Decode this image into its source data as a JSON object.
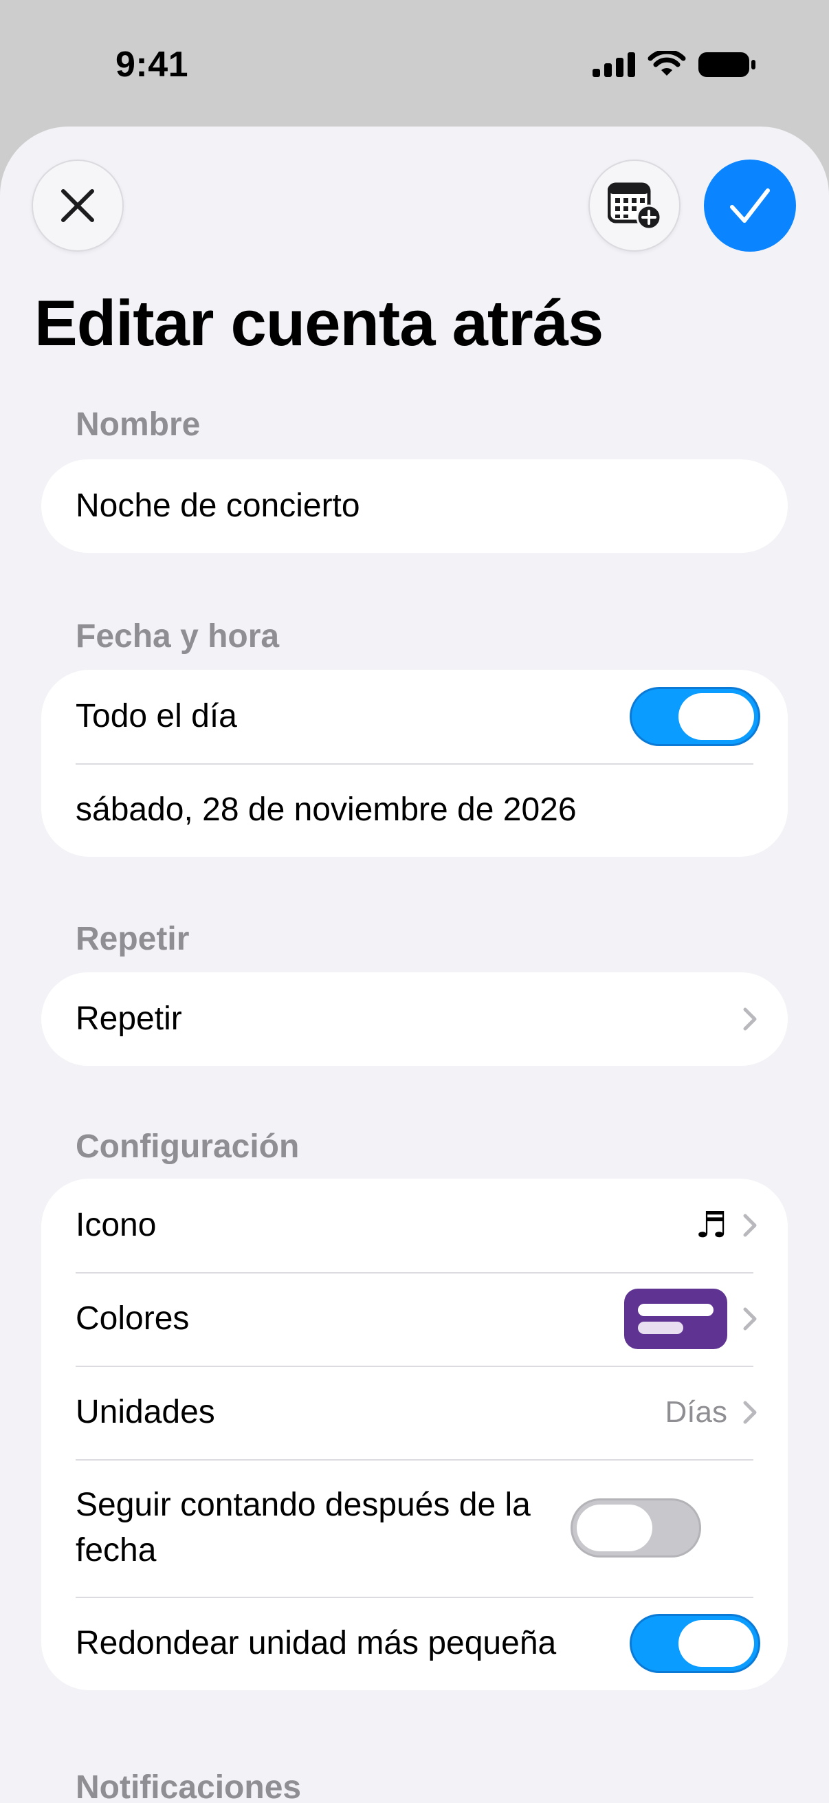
{
  "status_bar": {
    "time": "9:41"
  },
  "page": {
    "title": "Editar cuenta atrás"
  },
  "nav": {
    "close_icon": "close-icon",
    "calendar_add_icon": "calendar-add-icon",
    "done_icon": "checkmark-icon",
    "accent_color": "#0a84ff"
  },
  "sections": {
    "name": {
      "label": "Nombre",
      "value": "Noche de concierto"
    },
    "datetime": {
      "label": "Fecha y hora",
      "all_day_label": "Todo el día",
      "all_day_on": true,
      "date_value": "sábado, 28 de noviembre de 2026"
    },
    "repeat": {
      "label": "Repetir",
      "row_label": "Repetir"
    },
    "settings": {
      "label": "Configuración",
      "icon_label": "Icono",
      "icon_value": "♬",
      "colors_label": "Colores",
      "colors_swatch": "#5e3391",
      "units_label": "Unidades",
      "units_value": "Días",
      "keep_counting_label": "Seguir contando después de la fecha",
      "keep_counting_on": false,
      "round_label": "Redondear unidad más pequeña",
      "round_on": true
    },
    "notifications": {
      "label": "Notificaciones"
    }
  }
}
